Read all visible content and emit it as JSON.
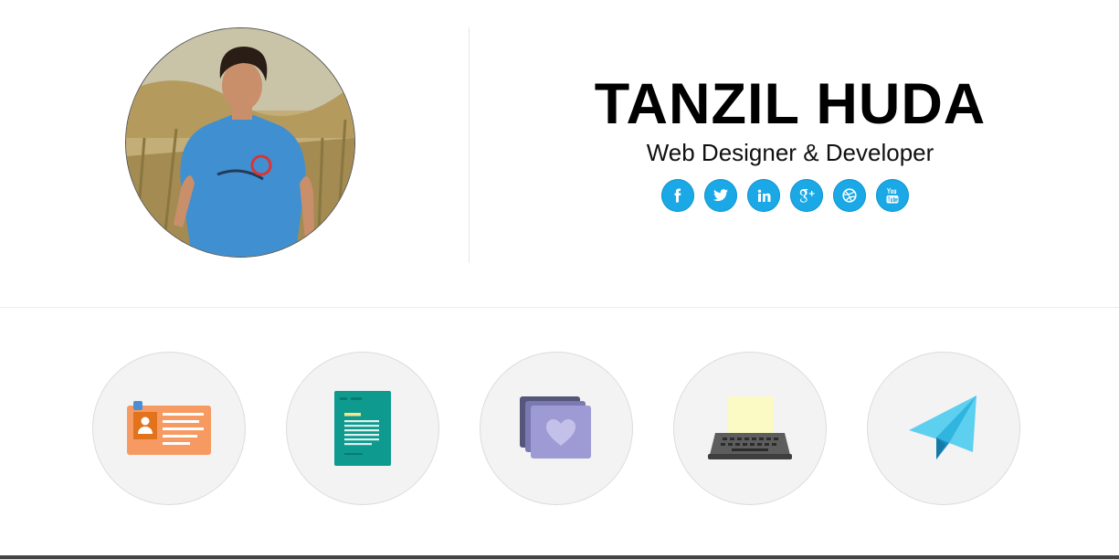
{
  "profile": {
    "name": "TANZIL HUDA",
    "tagline": "Web Designer & Developer"
  },
  "social_links": [
    {
      "icon": "facebook-icon"
    },
    {
      "icon": "twitter-icon"
    },
    {
      "icon": "linkedin-icon"
    },
    {
      "icon": "google-plus-icon"
    },
    {
      "icon": "dribbble-icon"
    },
    {
      "icon": "youtube-icon"
    }
  ],
  "menu": [
    {
      "icon": "id-card-icon"
    },
    {
      "icon": "document-icon"
    },
    {
      "icon": "portfolio-heart-icon"
    },
    {
      "icon": "typewriter-icon"
    },
    {
      "icon": "paper-plane-icon"
    }
  ],
  "colors": {
    "social_bg": "#1aa9e6",
    "menu_circle_bg": "#f3f3f3"
  }
}
